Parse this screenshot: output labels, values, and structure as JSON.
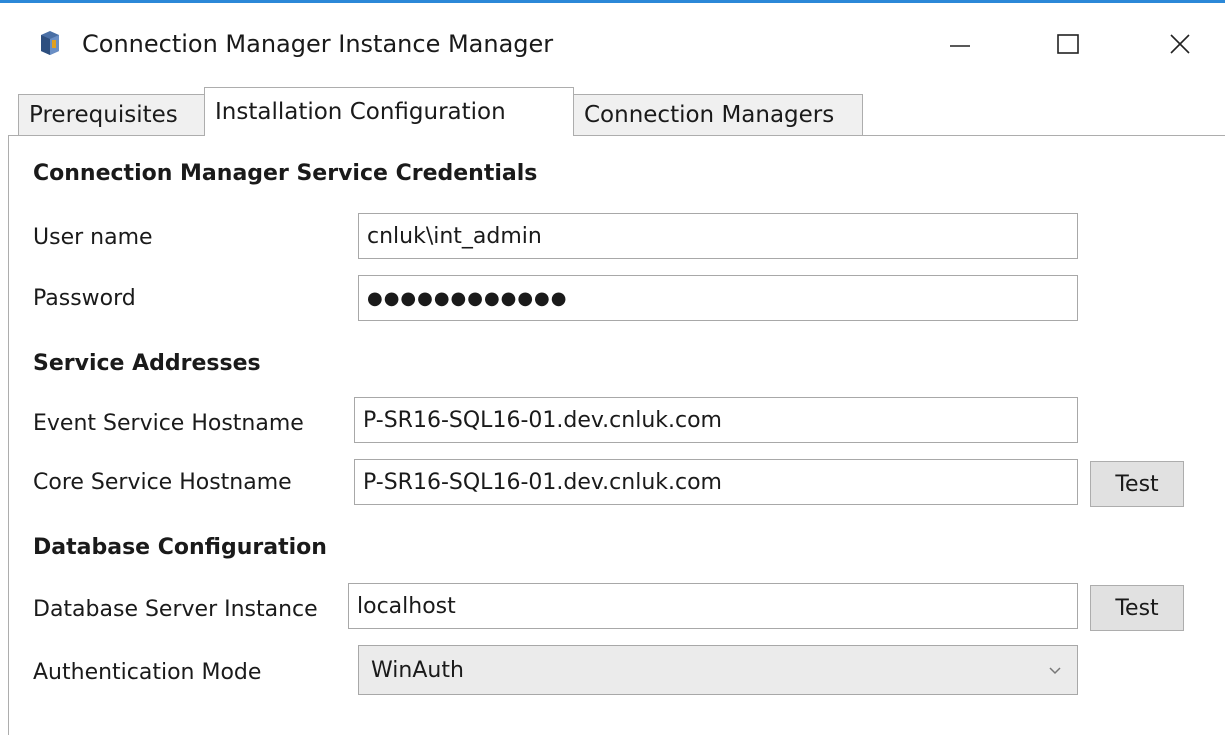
{
  "window": {
    "title": "Connection Manager Instance Manager",
    "accent_color": "#2b88d8"
  },
  "tabs": [
    {
      "label": "Prerequisites",
      "selected": false
    },
    {
      "label": "Installation Configuration",
      "selected": true
    },
    {
      "label": "Connection Managers",
      "selected": false
    }
  ],
  "credentials": {
    "section_title": "Connection Manager Service Credentials",
    "username_label": "User name",
    "username_value": "cnluk\\int_admin",
    "password_label": "Password",
    "password_value": "●●●●●●●●●●●●"
  },
  "addresses": {
    "section_title": "Service Addresses",
    "event_label": "Event Service Hostname",
    "event_value": "P-SR16-SQL16-01.dev.cnluk.com",
    "core_label": "Core Service Hostname",
    "core_value": "P-SR16-SQL16-01.dev.cnluk.com",
    "core_test_label": "Test"
  },
  "database": {
    "section_title": "Database Configuration",
    "instance_label": "Database Server Instance",
    "instance_value": "localhost",
    "instance_test_label": "Test",
    "auth_label": "Authentication Mode",
    "auth_value": "WinAuth"
  },
  "icons": {
    "app": "app-icon",
    "minimize": "minimize-icon",
    "maximize": "maximize-icon",
    "close": "close-icon",
    "dropdown": "chevron-down-icon"
  }
}
